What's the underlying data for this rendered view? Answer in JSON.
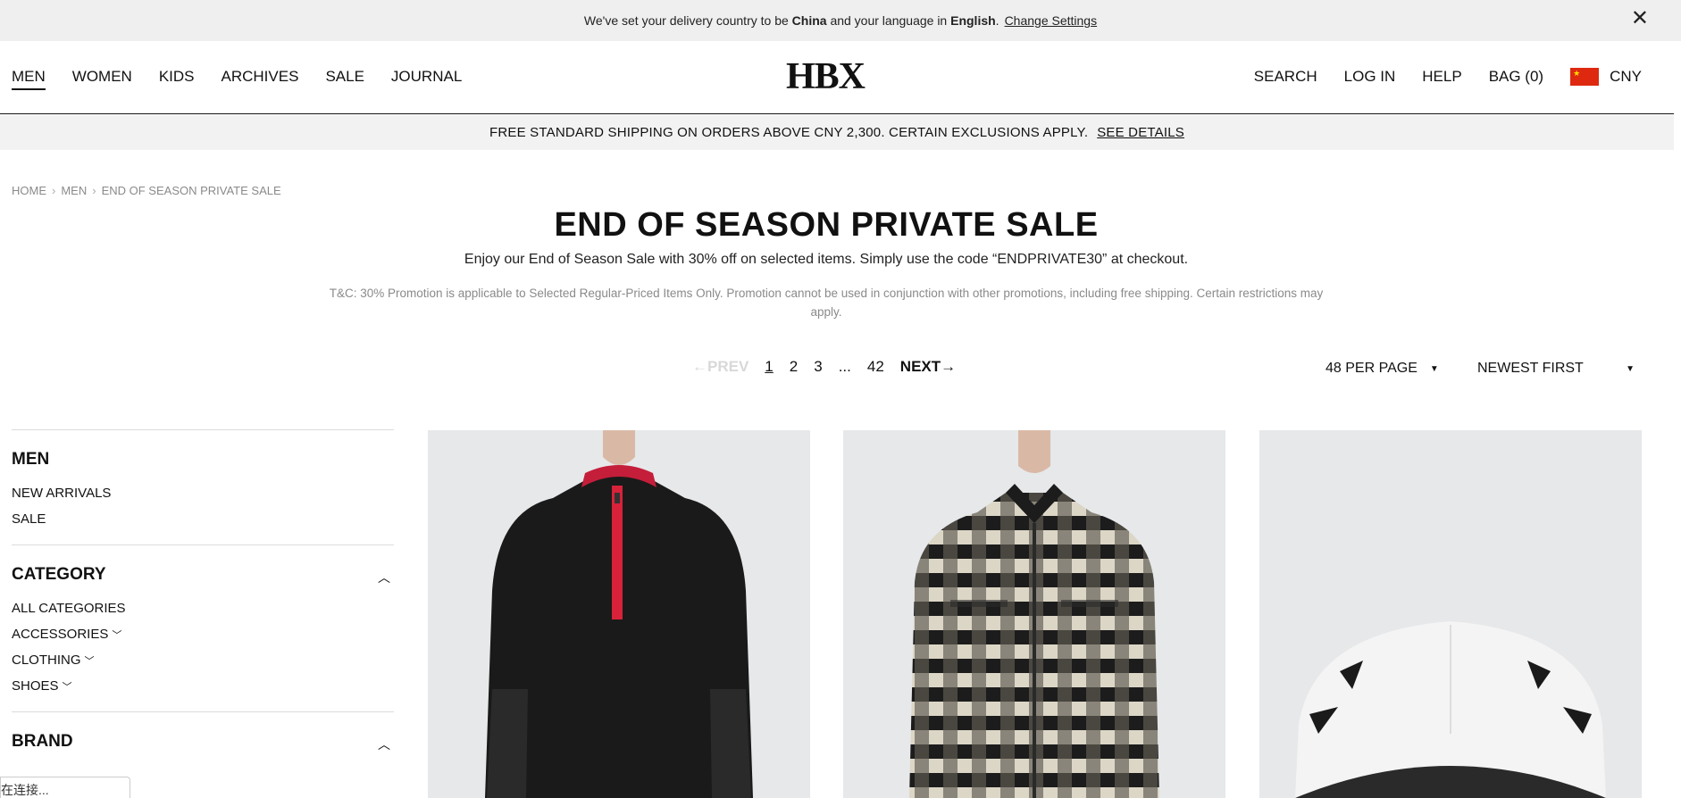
{
  "notice": {
    "text_pre": "We've set your delivery country to be",
    "country": "China",
    "text_mid": "and your language in",
    "language": "English",
    "link": "Change Settings",
    "close_icon": "close-icon"
  },
  "header": {
    "nav_left": [
      "MEN",
      "WOMEN",
      "KIDS",
      "ARCHIVES",
      "SALE",
      "JOURNAL"
    ],
    "logo": "HBX",
    "nav_right": {
      "search": "SEARCH",
      "login": "LOG IN",
      "help": "HELP",
      "bag": "BAG (0)",
      "currency": "CNY",
      "flag_icon": "china-flag-icon"
    }
  },
  "shipping": {
    "text": "FREE STANDARD SHIPPING ON ORDERS ABOVE CNY 2,300. CERTAIN EXCLUSIONS APPLY.",
    "link": "SEE DETAILS"
  },
  "breadcrumb": [
    "HOME",
    "MEN",
    "END OF SEASON PRIVATE SALE"
  ],
  "page": {
    "title": "END OF SEASON PRIVATE SALE",
    "subtitle": "Enjoy our End of Season Sale with 30% off on selected items. Simply use the code “ENDPRIVATE30” at checkout.",
    "terms": "T&C: 30% Promotion is applicable to Selected Regular-Priced Items Only. Promotion cannot be used in conjunction with other promotions, including free shipping. Certain restrictions may apply."
  },
  "pagination": {
    "prev": "←PREV",
    "pages": [
      "1",
      "2",
      "3",
      "...",
      "42"
    ],
    "current": "1",
    "next": "NEXT→"
  },
  "controls": {
    "per_page": "48 PER PAGE",
    "sort": "NEWEST FIRST"
  },
  "sidebar": {
    "men": {
      "heading": "MEN",
      "items": [
        "NEW ARRIVALS",
        "SALE"
      ]
    },
    "category": {
      "heading": "CATEGORY",
      "items": [
        "ALL CATEGORIES",
        "ACCESSORIES",
        "CLOTHING",
        "SHOES"
      ]
    },
    "brand": {
      "heading": "BRAND"
    }
  },
  "status": "在连接...",
  "colors": {
    "notice_bg": "#efefef",
    "shipping_bg": "#f2f2f2",
    "product_bg": "#e6e8ea",
    "muted_text": "#8a8a8a",
    "zip_accent": "#d8223a"
  },
  "products": [
    {
      "name": "black-red-half-zip-fleece"
    },
    {
      "name": "black-cream-check-shirt"
    },
    {
      "name": "white-black-arrows-cap"
    }
  ]
}
